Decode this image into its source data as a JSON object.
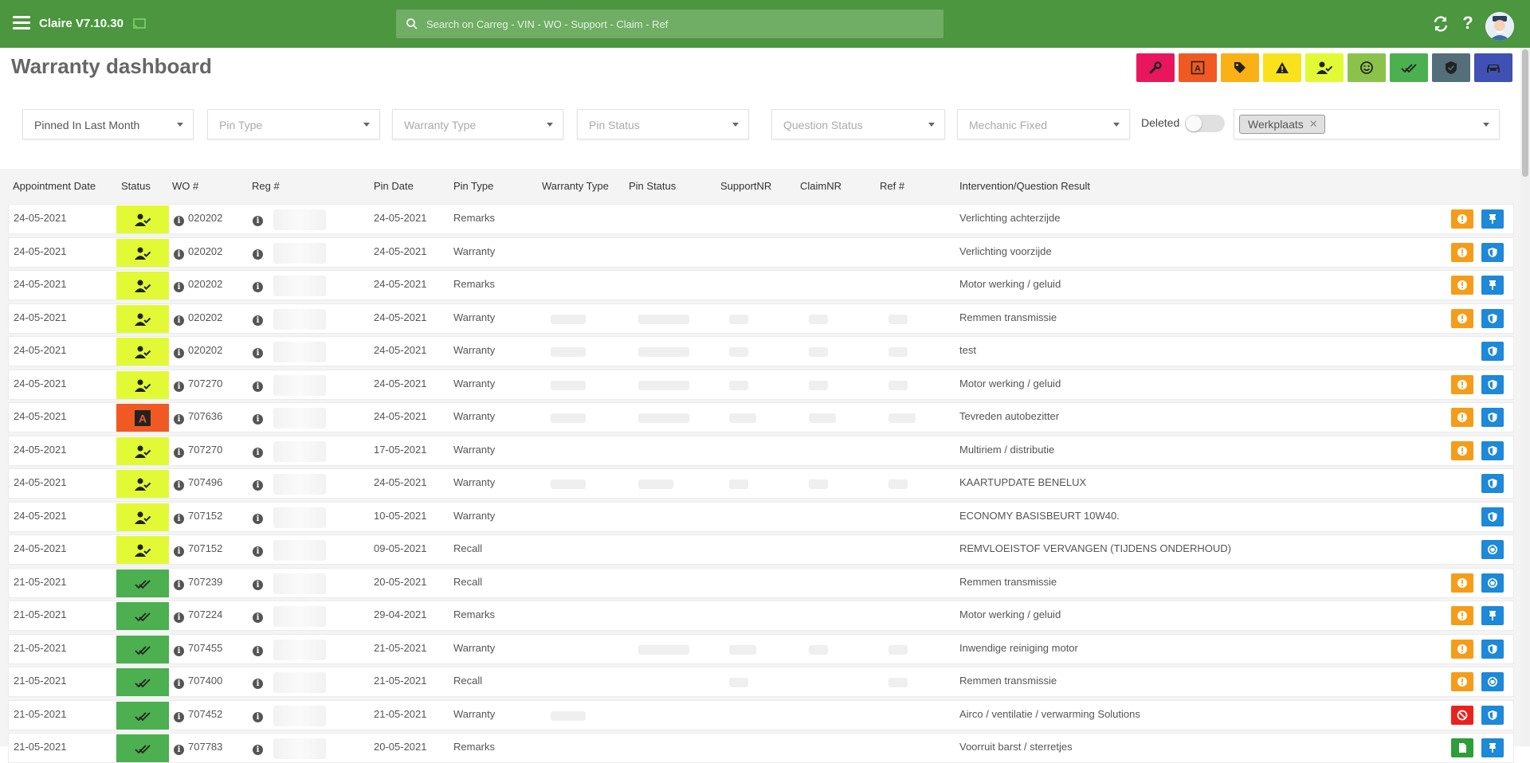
{
  "app": {
    "title": "Claire V7.10.30"
  },
  "search": {
    "placeholder": "Search on Carreg - VIN - WO - Support - Claim - Ref"
  },
  "page": {
    "title": "Warranty dashboard"
  },
  "quick_filters": [
    {
      "icon": "wrench-icon",
      "color": "#e8175d"
    },
    {
      "icon": "approval-a-icon",
      "color": "#f05a22"
    },
    {
      "icon": "tag-icon",
      "color": "#f9b115"
    },
    {
      "icon": "warning-icon",
      "color": "#f9e21b"
    },
    {
      "icon": "user-check-icon",
      "color": "#e2fa35"
    },
    {
      "icon": "smiley-icon",
      "color": "#8bc34a"
    },
    {
      "icon": "double-check-icon",
      "color": "#4caf50"
    },
    {
      "icon": "shield-icon",
      "color": "#546e7a"
    },
    {
      "icon": "car-icon",
      "color": "#3f51b5"
    }
  ],
  "filters": {
    "pinned": "Pinned In Last Month",
    "pin_type": "Pin Type",
    "warranty_type": "Warranty Type",
    "pin_status": "Pin Status",
    "question_status": "Question Status",
    "mechanic_fixed": "Mechanic Fixed",
    "deleted_label": "Deleted",
    "tag": "Werkplaats"
  },
  "columns": {
    "appointment_date": "Appointment Date",
    "status": "Status",
    "wo": "WO #",
    "reg": "Reg #",
    "pin_date": "Pin Date",
    "pin_type": "Pin Type",
    "warranty_type": "Warranty Type",
    "pin_status": "Pin Status",
    "support_nr": "SupportNR",
    "claim_nr": "ClaimNR",
    "ref": "Ref #",
    "result": "Intervention/Question Result"
  },
  "rows": [
    {
      "date": "24-05-2021",
      "status": "ok",
      "wo": "020202",
      "pin_date": "24-05-2021",
      "pin_type": "Remarks",
      "result": "Verlichting achterzijde",
      "actions": [
        "warn",
        "pin"
      ]
    },
    {
      "date": "24-05-2021",
      "status": "ok",
      "wo": "020202",
      "pin_date": "24-05-2021",
      "pin_type": "Warranty",
      "result": "Verlichting voorzijde",
      "actions": [
        "warn",
        "shield"
      ]
    },
    {
      "date": "24-05-2021",
      "status": "ok",
      "wo": "020202",
      "pin_date": "24-05-2021",
      "pin_type": "Remarks",
      "result": "Motor werking / geluid",
      "actions": [
        "warn",
        "pin"
      ]
    },
    {
      "date": "24-05-2021",
      "status": "ok",
      "wo": "020202",
      "pin_date": "24-05-2021",
      "pin_type": "Warranty",
      "result": "Remmen transmissie",
      "actions": [
        "warn",
        "shield"
      ]
    },
    {
      "date": "24-05-2021",
      "status": "ok",
      "wo": "020202",
      "pin_date": "24-05-2021",
      "pin_type": "Warranty",
      "result": "test",
      "actions": [
        "shield"
      ]
    },
    {
      "date": "24-05-2021",
      "status": "ok",
      "wo": "707270",
      "pin_date": "24-05-2021",
      "pin_type": "Warranty",
      "result": "Motor werking / geluid",
      "actions": [
        "warn",
        "shield"
      ]
    },
    {
      "date": "24-05-2021",
      "status": "appr",
      "wo": "707636",
      "pin_date": "24-05-2021",
      "pin_type": "Warranty",
      "result": "Tevreden autobezitter",
      "actions": [
        "warn",
        "shield"
      ]
    },
    {
      "date": "24-05-2021",
      "status": "ok",
      "wo": "707270",
      "pin_date": "17-05-2021",
      "pin_type": "Warranty",
      "result": "Multiriem / distributie",
      "actions": [
        "warn",
        "shield"
      ]
    },
    {
      "date": "24-05-2021",
      "status": "ok",
      "wo": "707496",
      "pin_date": "24-05-2021",
      "pin_type": "Warranty",
      "result": "KAARTUPDATE BENELUX",
      "actions": [
        "shield"
      ]
    },
    {
      "date": "24-05-2021",
      "status": "ok",
      "wo": "707152",
      "pin_date": "10-05-2021",
      "pin_type": "Warranty",
      "result": "ECONOMY BASISBEURT 10W40.",
      "actions": [
        "shield"
      ]
    },
    {
      "date": "24-05-2021",
      "status": "ok",
      "wo": "707152",
      "pin_date": "09-05-2021",
      "pin_type": "Recall",
      "result": "REMVLOEISTOF VERVANGEN (TIJDENS ONDERHOUD)",
      "actions": [
        "recall"
      ]
    },
    {
      "date": "21-05-2021",
      "status": "done",
      "wo": "707239",
      "pin_date": "20-05-2021",
      "pin_type": "Recall",
      "result": "Remmen transmissie",
      "actions": [
        "warn",
        "recall"
      ]
    },
    {
      "date": "21-05-2021",
      "status": "done",
      "wo": "707224",
      "pin_date": "29-04-2021",
      "pin_type": "Remarks",
      "result": "Motor werking / geluid",
      "actions": [
        "warn",
        "pin"
      ]
    },
    {
      "date": "21-05-2021",
      "status": "done",
      "wo": "707455",
      "pin_date": "21-05-2021",
      "pin_type": "Warranty",
      "result": "Inwendige reiniging motor",
      "actions": [
        "warn",
        "shield"
      ]
    },
    {
      "date": "21-05-2021",
      "status": "done",
      "wo": "707400",
      "pin_date": "21-05-2021",
      "pin_type": "Recall",
      "result": "Remmen transmissie",
      "actions": [
        "warn",
        "recall"
      ]
    },
    {
      "date": "21-05-2021",
      "status": "done",
      "wo": "707452",
      "pin_date": "21-05-2021",
      "pin_type": "Warranty",
      "result": "Airco / ventilatie / verwarming Solutions",
      "actions": [
        "block",
        "shield"
      ]
    },
    {
      "date": "21-05-2021",
      "status": "done",
      "wo": "707783",
      "pin_date": "20-05-2021",
      "pin_type": "Remarks",
      "result": "Voorruit barst / sterretjes",
      "actions": [
        "doc",
        "pin"
      ]
    }
  ]
}
